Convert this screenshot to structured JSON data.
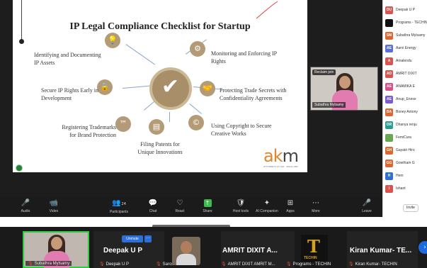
{
  "slide": {
    "title": "IP Legal Compliance Checklist for Startup",
    "items": [
      {
        "text": "Identifying and Documenting IP Assets",
        "icon": "lightbulb-icon"
      },
      {
        "text": "Monitoring and Enforcing IP Rights",
        "icon": "gears-icon"
      },
      {
        "text": "Secure IP Rights Early in Development",
        "icon": "lock-icon"
      },
      {
        "text": "Protecting Trade Secrets with Confidentiality Agreements",
        "icon": "handshake-icon"
      },
      {
        "text": "Registering Trademarks for Brand Protection",
        "icon": "trademark-icon"
      },
      {
        "text": "Using Copyright to Secure Creative Works",
        "icon": "copyright-icon"
      },
      {
        "text": "Filing Patents for Unique Innovations",
        "icon": "document-icon"
      }
    ],
    "logo": {
      "a": "ak",
      "b": "m"
    },
    "logo_sub": "ATTORNEYS AT LAW · SINCE 1960"
  },
  "speaker": {
    "tag": "Reclaim join",
    "name": "Subathra Mylsamy"
  },
  "toolbar": {
    "audio": "Audio",
    "video": "Video",
    "participants": "Participants",
    "participants_count": "24",
    "chat": "Chat",
    "react": "React",
    "share": "Share",
    "host_tools": "Host tools",
    "ai_companion": "AI Companion",
    "apps": "Apps",
    "more": "More",
    "leave": "Leave"
  },
  "participants": [
    {
      "initials": "DU",
      "name": "Deepak U P",
      "color": "#d9534f"
    },
    {
      "initials": "",
      "name": "Programs - TECHIN",
      "color": "#111111"
    },
    {
      "initials": "SM",
      "name": "Subathra Mylsamy",
      "color": "#e0662f"
    },
    {
      "initials": "AE",
      "name": "Aarvi Energy",
      "color": "#5b6fd6"
    },
    {
      "initials": "A",
      "name": "Amalendu",
      "color": "#d9534f"
    },
    {
      "initials": "AD",
      "name": "AMRIT DIXIT",
      "color": "#d9534f"
    },
    {
      "initials": "AE",
      "name": "ANAMIKA E",
      "color": "#d94f8a"
    },
    {
      "initials": "AE",
      "name": "Anup_Enexe",
      "color": "#7a5bd6"
    },
    {
      "initials": "BA",
      "name": "Boney Antony",
      "color": "#e0662f"
    },
    {
      "initials": "DR",
      "name": "Dhanya renju",
      "color": "#2a9d8f"
    },
    {
      "initials": "",
      "name": "FemiCura",
      "color": "#6aa84f"
    },
    {
      "initials": "GH",
      "name": "Gayatri Hiro",
      "color": "#e0662f"
    },
    {
      "initials": "GG",
      "name": "Gowtham G",
      "color": "#e0662f"
    },
    {
      "initials": "H",
      "name": "Hem",
      "color": "#2d6fd6"
    },
    {
      "initials": "I",
      "name": "Ishant",
      "color": "#d9534f"
    }
  ],
  "invite": "Invite",
  "gallery": {
    "unmute": "Unmute",
    "more": "···",
    "tiles": [
      {
        "label": "Subathra Mylsamy",
        "big": ""
      },
      {
        "label": "Deepak U P",
        "big": "Deepak U P"
      },
      {
        "label": "Sarosh Kothandath",
        "big": ""
      },
      {
        "label": "AMRIT DIXIT AMRIT M...",
        "big": "AMRIT DIXIT A..."
      },
      {
        "label": "Programs - TECHIN",
        "big": "",
        "logo": "TECHIN"
      },
      {
        "label": "Kiran Kumar- TECHIN",
        "big": "Kiran Kumar- TE..."
      }
    ]
  }
}
